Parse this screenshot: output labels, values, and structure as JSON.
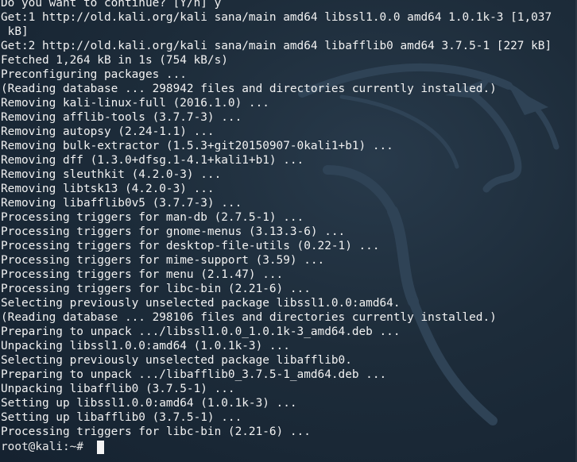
{
  "terminal": {
    "lines": [
      "Do you want to continue? [Y/n] y",
      "Get:1 http://old.kali.org/kali sana/main amd64 libssl1.0.0 amd64 1.0.1k-3 [1,037",
      " kB]",
      "Get:2 http://old.kali.org/kali sana/main amd64 libafflib0 amd64 3.7.5-1 [227 kB]",
      "Fetched 1,264 kB in 1s (754 kB/s)",
      "Preconfiguring packages ...",
      "(Reading database ... 298942 files and directories currently installed.)",
      "Removing kali-linux-full (2016.1.0) ...",
      "Removing afflib-tools (3.7.7-3) ...",
      "Removing autopsy (2.24-1.1) ...",
      "Removing bulk-extractor (1.5.3+git20150907-0kali1+b1) ...",
      "Removing dff (1.3.0+dfsg.1-4.1+kali1+b1) ...",
      "Removing sleuthkit (4.2.0-3) ...",
      "Removing libtsk13 (4.2.0-3) ...",
      "Removing libafflib0v5 (3.7.7-3) ...",
      "Processing triggers for man-db (2.7.5-1) ...",
      "Processing triggers for gnome-menus (3.13.3-6) ...",
      "Processing triggers for desktop-file-utils (0.22-1) ...",
      "Processing triggers for mime-support (3.59) ...",
      "Processing triggers for menu (2.1.47) ...",
      "Processing triggers for libc-bin (2.21-6) ...",
      "Selecting previously unselected package libssl1.0.0:amd64.",
      "(Reading database ... 298106 files and directories currently installed.)",
      "Preparing to unpack .../libssl1.0.0_1.0.1k-3_amd64.deb ...",
      "Unpacking libssl1.0.0:amd64 (1.0.1k-3) ...",
      "Selecting previously unselected package libafflib0.",
      "Preparing to unpack .../libafflib0_3.7.5-1_amd64.deb ...",
      "Unpacking libafflib0 (3.7.5-1) ...",
      "Setting up libssl1.0.0:amd64 (1.0.1k-3) ...",
      "Setting up libafflib0 (3.7.5-1) ...",
      "Processing triggers for libc-bin (2.21-6) ..."
    ],
    "prompt": "root@kali:~# ",
    "colors": {
      "background": "#1d2c3a",
      "text": "#f2f2f2",
      "dragon": "#2e4152"
    }
  }
}
